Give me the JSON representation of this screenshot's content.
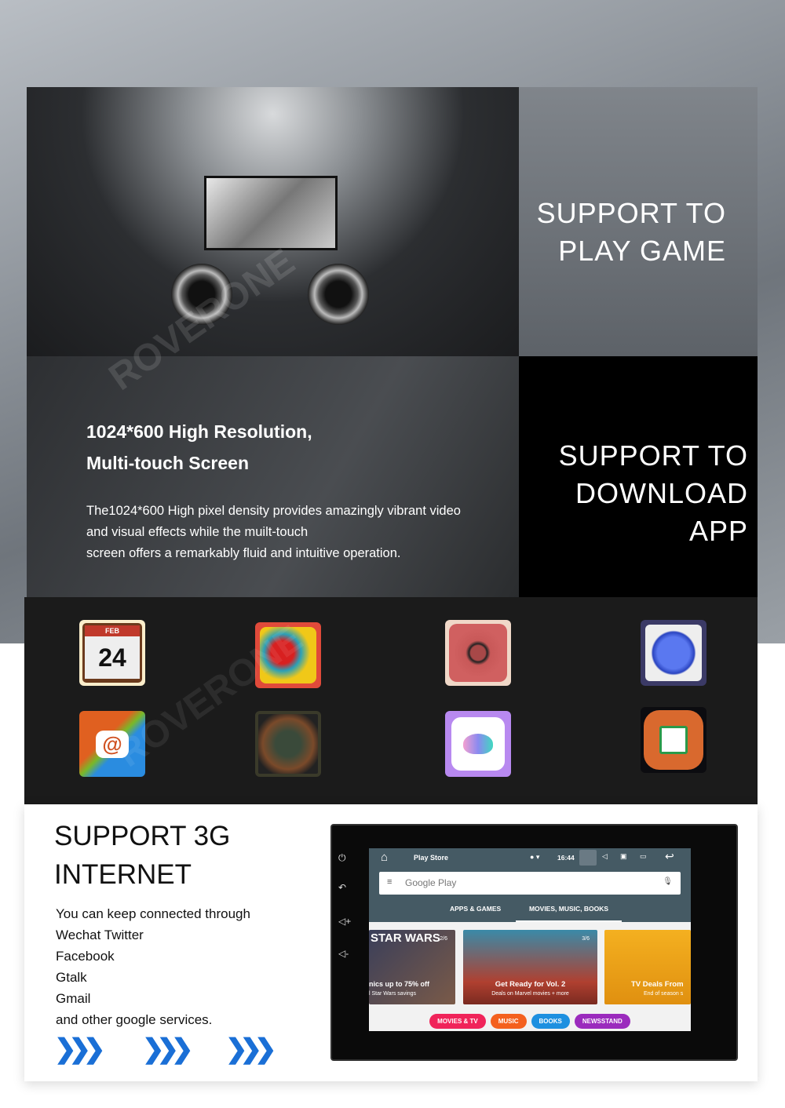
{
  "game_panel": {
    "line1": "SUPPORT TO",
    "line2": "PLAY GAME"
  },
  "resolution_panel": {
    "title1": "1024*600 High Resolution,",
    "title2": "Multi-touch Screen",
    "body1": "The1024*600 High pixel density provides amazingly vibrant video",
    "body2": "and visual effects while the muilt-touch",
    "body3": "screen offers a remarkably fluid and intuitive operation."
  },
  "app_panel": {
    "line1": "SUPPORT TO",
    "line2": "DOWNLOAD APP"
  },
  "app_icons": [
    {
      "name": "calendar-icon",
      "month": "FEB",
      "day": "24",
      "color": "#c0392b"
    },
    {
      "name": "game-pepper-icon",
      "color": "#e0b020"
    },
    {
      "name": "phone-dial-icon",
      "color": "#c95a5a"
    },
    {
      "name": "headphones-icon",
      "color": "#3b5ad8"
    },
    {
      "name": "email-icon",
      "color": "#1e7fd0"
    },
    {
      "name": "game-cannon-icon",
      "color": "#6b4a2a"
    },
    {
      "name": "lotus-gallery-icon",
      "color": "#b889f0"
    },
    {
      "name": "sync-icon",
      "color": "#d9692e"
    }
  ],
  "internet": {
    "title1": "SUPPORT 3G",
    "title2": "INTERNET",
    "lines": [
      "You can keep connected through",
      "Wechat Twitter",
      "Facebook",
      "Gtalk",
      "Gmail",
      "and other google services."
    ]
  },
  "device": {
    "status": {
      "app": "Play Store",
      "time": "16:44"
    },
    "search_placeholder": "Google Play",
    "tabs": [
      "APPS & GAMES",
      "MOVIES, MUSIC, BOOKS"
    ],
    "active_tab": 1,
    "cards": [
      {
        "badge": "2/6",
        "title": "nics up to 75% off",
        "sub": "l Star Wars savings",
        "logo": "STAR WARS"
      },
      {
        "badge": "3/6",
        "title": "Get Ready for Vol. 2",
        "sub": "Deals on Marvel movies + more"
      },
      {
        "title": "TV Deals From",
        "sub": "End of season s"
      }
    ],
    "pills": [
      {
        "label": "MOVIES & TV",
        "color": "#f0245a"
      },
      {
        "label": "MUSIC",
        "color": "#f4601e"
      },
      {
        "label": "BOOKS",
        "color": "#1e90e0"
      },
      {
        "label": "NEWSSTAND",
        "color": "#9b2bbd"
      }
    ]
  },
  "watermark": "ROVERONE"
}
